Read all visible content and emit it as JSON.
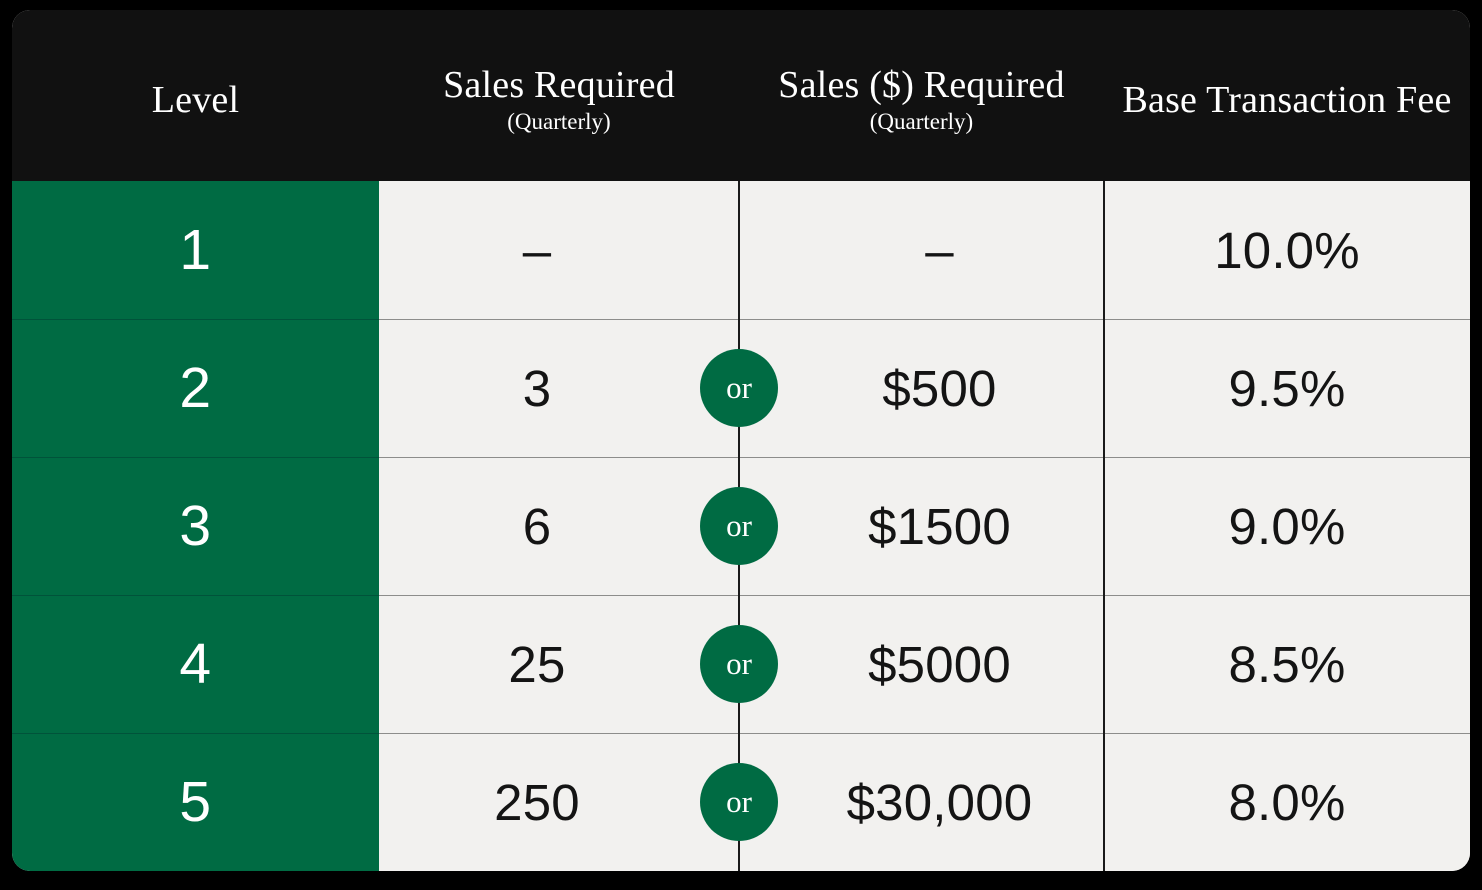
{
  "card": {
    "background_dark": "#111111",
    "background_light": "#F2F1EF",
    "accent_green": "#006B43",
    "divider_color": "#1A1A1A"
  },
  "header": {
    "columns": [
      {
        "title": "Level",
        "subtitle": "",
        "two_line": false
      },
      {
        "title": "Sales Required",
        "subtitle": "(Quarterly)",
        "two_line": false
      },
      {
        "title": "Sales ($) Required",
        "subtitle": "(Quarterly)",
        "two_line": false
      },
      {
        "title": "Base Transaction Fee",
        "subtitle": "",
        "two_line": true
      }
    ]
  },
  "or_label": "or",
  "rows": [
    {
      "level": "1",
      "sales_required": "–",
      "sales_dollars": "–",
      "fee": "10.0%",
      "has_or": false
    },
    {
      "level": "2",
      "sales_required": "3",
      "sales_dollars": "$500",
      "fee": "9.5%",
      "has_or": true
    },
    {
      "level": "3",
      "sales_required": "6",
      "sales_dollars": "$1500",
      "fee": "9.0%",
      "has_or": true
    },
    {
      "level": "4",
      "sales_required": "25",
      "sales_dollars": "$5000",
      "fee": "8.5%",
      "has_or": true
    },
    {
      "level": "5",
      "sales_required": "250",
      "sales_dollars": "$30,000",
      "fee": "8.0%",
      "has_or": true
    }
  ]
}
